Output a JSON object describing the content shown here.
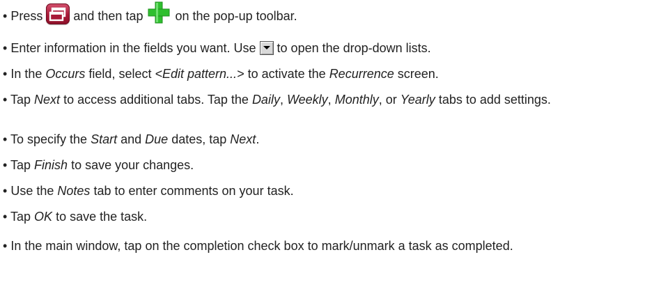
{
  "bullet": "•",
  "items": [
    {
      "parts": [
        "Press",
        "and then tap",
        "on the pop-up toolbar."
      ]
    },
    {
      "parts": [
        "Enter information in the fields you want. Use",
        "to open the drop-down lists."
      ]
    },
    {
      "parts": [
        "In the",
        "Occurs",
        "field, select",
        "<Edit pattern...>",
        "to activate the",
        "Recurrence",
        "screen."
      ]
    },
    {
      "parts": [
        "Tap",
        "Next",
        "to access additional tabs. Tap the",
        "Daily",
        ",",
        "Weekly",
        ",",
        "Monthly",
        ", or",
        "Yearly",
        "tabs to add settings."
      ]
    },
    {
      "parts": [
        "To specify the",
        "Start",
        "and",
        "Due",
        "dates, tap",
        "Next",
        "."
      ]
    },
    {
      "parts": [
        "Tap",
        "Finish",
        "to save your changes."
      ]
    },
    {
      "parts": [
        "Use the",
        "Notes",
        "tab to enter comments on your task."
      ]
    },
    {
      "parts": [
        "Tap",
        "OK",
        "to save the task."
      ]
    },
    {
      "parts": [
        "In the main window, tap on the completion check box to mark/unmark a task as completed."
      ]
    }
  ],
  "icons": {
    "tasks": "tasks-icon",
    "add": "plus-icon",
    "dropdown": "dropdown-arrow-icon"
  },
  "colors": {
    "tasks_icon": "#a81a38",
    "plus_icon": "#2fbf2f"
  }
}
